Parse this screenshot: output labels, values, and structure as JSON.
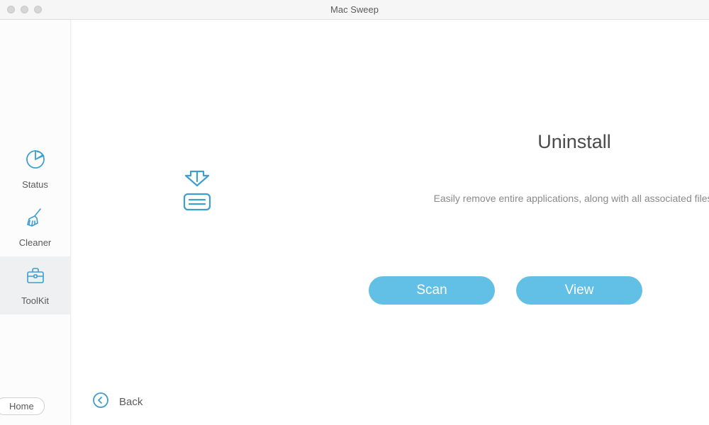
{
  "window": {
    "title": "Mac Sweep"
  },
  "sidebar": {
    "items": [
      {
        "label": "Status"
      },
      {
        "label": "Cleaner"
      },
      {
        "label": "ToolKit"
      }
    ],
    "home_label": "Home"
  },
  "main": {
    "feature_title": "Uninstall",
    "feature_desc": "Easily remove entire applications, along with all associated files.",
    "scan_label": "Scan",
    "view_label": "View",
    "back_label": "Back"
  }
}
